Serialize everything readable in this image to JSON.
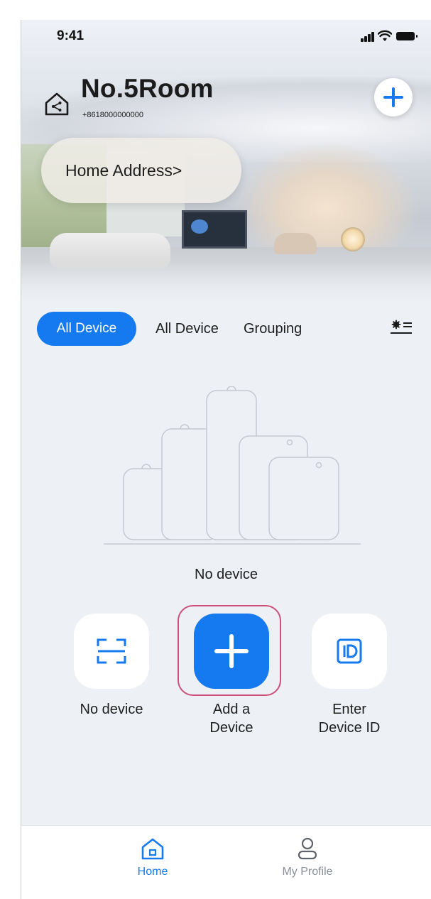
{
  "status_bar": {
    "time": "9:41"
  },
  "header": {
    "room_name": "No.5Room",
    "phone": "+8618000000000",
    "address_label": "Home Address>"
  },
  "tabs": [
    {
      "label": "All Device",
      "active": true
    },
    {
      "label": "All Device"
    },
    {
      "label": "Grouping"
    }
  ],
  "empty_state": {
    "message": "No device"
  },
  "actions": [
    {
      "label": "No device",
      "icon": "scan-icon"
    },
    {
      "label_line1": "Add a",
      "label_line2": "Device",
      "icon": "plus-icon"
    },
    {
      "label_line1": "Enter",
      "label_line2": "Device ID",
      "icon": "id-icon"
    }
  ],
  "bottom_nav": {
    "home": {
      "label": "Home",
      "icon": "home-icon",
      "active": true
    },
    "profile": {
      "label": "My Profile",
      "icon": "profile-icon"
    }
  },
  "colors": {
    "accent": "#1579f0",
    "background": "#edf0f5",
    "highlight": "#d04e7a",
    "inactive": "#8a8f98"
  }
}
